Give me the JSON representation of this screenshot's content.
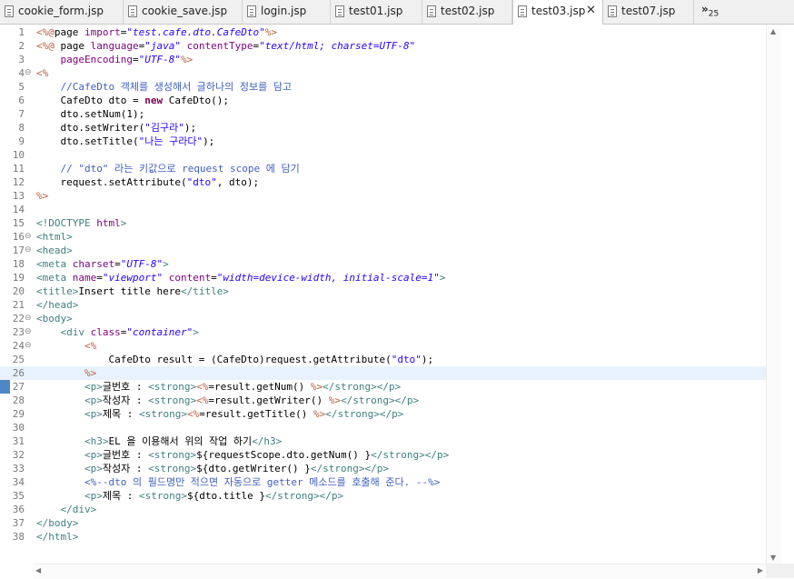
{
  "tabs": [
    {
      "label": "cookie_form.jsp",
      "active": false
    },
    {
      "label": "cookie_save.jsp",
      "active": false
    },
    {
      "label": "login.jsp",
      "active": false
    },
    {
      "label": "test01.jsp",
      "active": false
    },
    {
      "label": "test02.jsp",
      "active": false
    },
    {
      "label": "test03.jsp",
      "active": true
    },
    {
      "label": "test07.jsp",
      "active": false
    }
  ],
  "tab_close_glyph": "✕",
  "overflow": {
    "glyph": "»",
    "count": "25"
  },
  "colors": {
    "jsp_delim": "#bf5f3f",
    "keyword": "#7f0055",
    "tag": "#3f7f7f",
    "attr": "#7f007f",
    "string": "#2a00ff",
    "comment": "#3f5fbf",
    "plain": "#000000",
    "current_line": "#e8f2fe"
  },
  "current_line": 26,
  "folds": [
    4,
    16,
    17,
    22,
    23,
    24
  ],
  "lines": [
    [
      [
        "d",
        "<%@"
      ],
      [
        "p",
        "page "
      ],
      [
        "a",
        "import"
      ],
      [
        "p",
        "="
      ],
      [
        "s",
        "\"test.cafe.dto.CafeDto\""
      ],
      [
        "d",
        "%>"
      ]
    ],
    [
      [
        "d",
        "<%@ "
      ],
      [
        "p",
        "page "
      ],
      [
        "a",
        "language"
      ],
      [
        "p",
        "="
      ],
      [
        "s",
        "\"java\""
      ],
      [
        "p",
        " "
      ],
      [
        "a",
        "contentType"
      ],
      [
        "p",
        "="
      ],
      [
        "s",
        "\"text/html; charset=UTF-8\""
      ]
    ],
    [
      [
        "p",
        "    "
      ],
      [
        "a",
        "pageEncoding"
      ],
      [
        "p",
        "="
      ],
      [
        "s",
        "\"UTF-8\""
      ],
      [
        "d",
        "%>"
      ]
    ],
    [
      [
        "d",
        "<%"
      ]
    ],
    [
      [
        "p",
        "    "
      ],
      [
        "c",
        "//CafeDto 객체를 생성해서 글하나의 정보를 담고"
      ]
    ],
    [
      [
        "p",
        "    CafeDto dto = "
      ],
      [
        "k",
        "new"
      ],
      [
        "p",
        " CafeDto();"
      ]
    ],
    [
      [
        "p",
        "    dto.setNum(1);"
      ]
    ],
    [
      [
        "p",
        "    dto.setWriter("
      ],
      [
        "s",
        "\"김구라\""
      ],
      [
        "p",
        ");"
      ]
    ],
    [
      [
        "p",
        "    dto.setTitle("
      ],
      [
        "s",
        "\"나는 구라다\""
      ],
      [
        "p",
        ");"
      ]
    ],
    [],
    [
      [
        "p",
        "    "
      ],
      [
        "c",
        "// \"dto\" 라는 키값으로 request scope 에 담기"
      ]
    ],
    [
      [
        "p",
        "    request.setAttribute("
      ],
      [
        "s",
        "\"dto\""
      ],
      [
        "p",
        ", dto);"
      ]
    ],
    [
      [
        "d",
        "%>"
      ]
    ],
    [],
    [
      [
        "t",
        "<!DOCTYPE "
      ],
      [
        "a",
        "html"
      ],
      [
        "t",
        ">"
      ]
    ],
    [
      [
        "t",
        "<html>"
      ]
    ],
    [
      [
        "t",
        "<head>"
      ]
    ],
    [
      [
        "t",
        "<meta "
      ],
      [
        "a",
        "charset"
      ],
      [
        "p",
        "="
      ],
      [
        "s",
        "\"UTF-8\""
      ],
      [
        "t",
        ">"
      ]
    ],
    [
      [
        "t",
        "<meta "
      ],
      [
        "a",
        "name"
      ],
      [
        "p",
        "="
      ],
      [
        "s",
        "\"viewport\""
      ],
      [
        "p",
        " "
      ],
      [
        "a",
        "content"
      ],
      [
        "p",
        "="
      ],
      [
        "s",
        "\"width=device-width, initial-scale=1\""
      ],
      [
        "t",
        ">"
      ]
    ],
    [
      [
        "t",
        "<title>"
      ],
      [
        "p",
        "Insert title here"
      ],
      [
        "t",
        "</title>"
      ]
    ],
    [
      [
        "t",
        "</head>"
      ]
    ],
    [
      [
        "t",
        "<body>"
      ]
    ],
    [
      [
        "p",
        "    "
      ],
      [
        "t",
        "<div "
      ],
      [
        "a",
        "class"
      ],
      [
        "p",
        "="
      ],
      [
        "s",
        "\"container\""
      ],
      [
        "t",
        ">"
      ]
    ],
    [
      [
        "p",
        "        "
      ],
      [
        "d",
        "<%"
      ]
    ],
    [
      [
        "p",
        "            CafeDto result = (CafeDto)request.getAttribute("
      ],
      [
        "s",
        "\"dto\""
      ],
      [
        "p",
        ");"
      ]
    ],
    [
      [
        "p",
        "        "
      ],
      [
        "d",
        "%>"
      ]
    ],
    [
      [
        "p",
        "        "
      ],
      [
        "t",
        "<p>"
      ],
      [
        "p",
        "글번호 : "
      ],
      [
        "t",
        "<strong>"
      ],
      [
        "d",
        "<%"
      ],
      [
        "p",
        "=result.getNum() "
      ],
      [
        "d",
        "%>"
      ],
      [
        "t",
        "</strong></p>"
      ]
    ],
    [
      [
        "p",
        "        "
      ],
      [
        "t",
        "<p>"
      ],
      [
        "p",
        "작성자 : "
      ],
      [
        "t",
        "<strong>"
      ],
      [
        "d",
        "<%"
      ],
      [
        "p",
        "=result.getWriter() "
      ],
      [
        "d",
        "%>"
      ],
      [
        "t",
        "</strong></p>"
      ]
    ],
    [
      [
        "p",
        "        "
      ],
      [
        "t",
        "<p>"
      ],
      [
        "p",
        "제목 : "
      ],
      [
        "t",
        "<strong>"
      ],
      [
        "d",
        "<%"
      ],
      [
        "p",
        "=result.getTitle() "
      ],
      [
        "d",
        "%>"
      ],
      [
        "t",
        "</strong></p>"
      ]
    ],
    [],
    [
      [
        "p",
        "        "
      ],
      [
        "t",
        "<h3>"
      ],
      [
        "p",
        "EL 을 이용해서 위의 작업 하기"
      ],
      [
        "t",
        "</h3>"
      ]
    ],
    [
      [
        "p",
        "        "
      ],
      [
        "t",
        "<p>"
      ],
      [
        "p",
        "글번호 : "
      ],
      [
        "t",
        "<strong>"
      ],
      [
        "p",
        "${requestScope.dto.getNum() }"
      ],
      [
        "t",
        "</strong></p>"
      ]
    ],
    [
      [
        "p",
        "        "
      ],
      [
        "t",
        "<p>"
      ],
      [
        "p",
        "작성자 : "
      ],
      [
        "t",
        "<strong>"
      ],
      [
        "p",
        "${dto.getWriter() }"
      ],
      [
        "t",
        "</strong></p>"
      ]
    ],
    [
      [
        "p",
        "        "
      ],
      [
        "c",
        "<%--dto 의 필드명만 적으면 자동으로 getter 메소드를 호출해 준다. --%>"
      ]
    ],
    [
      [
        "p",
        "        "
      ],
      [
        "t",
        "<p>"
      ],
      [
        "p",
        "제목 : "
      ],
      [
        "t",
        "<strong>"
      ],
      [
        "p",
        "${dto.title }"
      ],
      [
        "t",
        "</strong></p>"
      ]
    ],
    [
      [
        "p",
        "    "
      ],
      [
        "t",
        "</div>"
      ]
    ],
    [
      [
        "t",
        "</body>"
      ]
    ],
    [
      [
        "t",
        "</html>"
      ]
    ]
  ]
}
